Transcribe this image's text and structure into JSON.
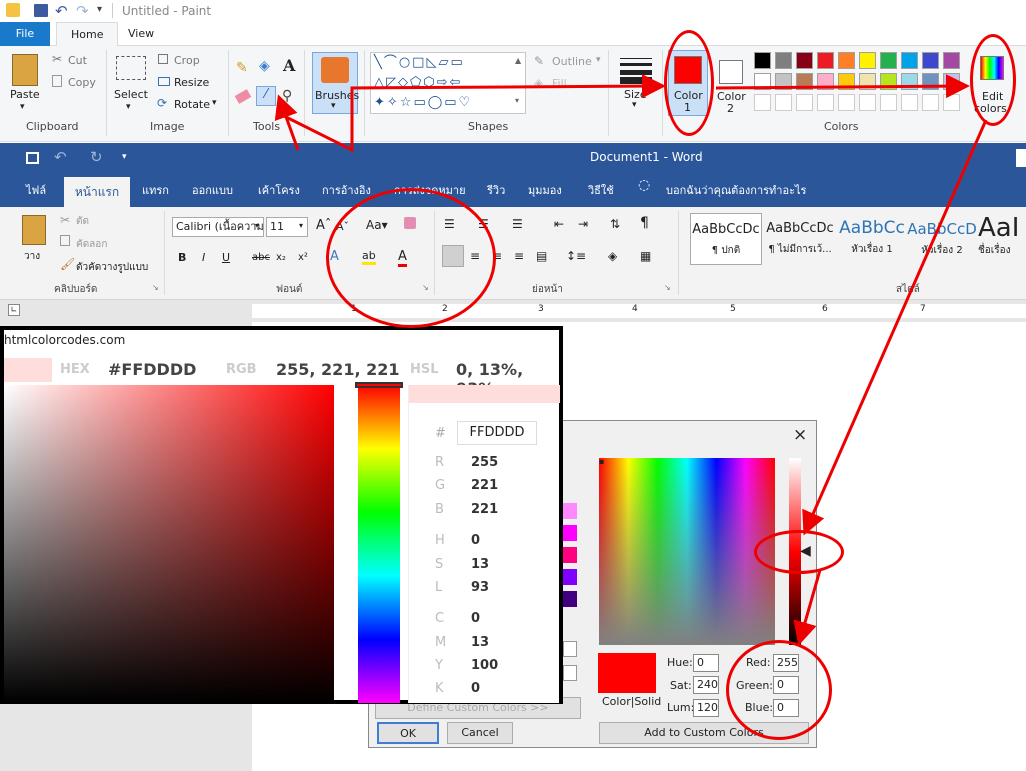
{
  "paint": {
    "title": "Untitled - Paint",
    "tabs": [
      "File",
      "Home",
      "View"
    ],
    "clipboard": {
      "paste": "Paste",
      "cut": "Cut",
      "copy": "Copy",
      "label": "Clipboard"
    },
    "image": {
      "select": "Select",
      "crop": "Crop",
      "resize": "Resize",
      "rotate": "Rotate",
      "label": "Image"
    },
    "tools": {
      "label": "Tools",
      "text_glyph": "A"
    },
    "brushes": "Brushes",
    "shapes": {
      "outline": "Outline",
      "fill": "Fill",
      "label": "Shapes"
    },
    "size": "Size",
    "color1": {
      "line1": "Color",
      "line2": "1",
      "value": "#ff0000"
    },
    "color2": {
      "line1": "Color",
      "line2": "2"
    },
    "colors_label": "Colors",
    "edit_colors": {
      "line1": "Edit",
      "line2": "colors"
    },
    "palette_row1": [
      "#000000",
      "#7f7f7f",
      "#880015",
      "#ed1c24",
      "#ff7f27",
      "#fff200",
      "#22b14c",
      "#00a2e8",
      "#3f48cc",
      "#a349a4"
    ],
    "palette_row2": [
      "#ffffff",
      "#c3c3c3",
      "#b97a57",
      "#ffaec9",
      "#ffc90e",
      "#efe4b0",
      "#b5e61d",
      "#99d9ea",
      "#7092be",
      "#c8bfe7"
    ]
  },
  "word": {
    "title": "Document1 - Word",
    "tabs": [
      "ไฟล์",
      "หน้าแรก",
      "แทรก",
      "ออกแบบ",
      "เค้าโครง",
      "การอ้างอิง",
      "การส่งจดหมาย",
      "รีวิว",
      "มุมมอง",
      "วิธีใช้"
    ],
    "tell_me": "บอกฉันว่าคุณต้องการทำอะไร",
    "paste": "วาง",
    "cut": "ตัด",
    "copy": "คัดลอก",
    "format_painter": "ตัวคัดวางรูปแบบ",
    "clipboard_label": "คลิปบอร์ด",
    "font_name": "Calibri (เนื้อความ",
    "font_size": "11",
    "font_label": "ฟอนต์",
    "paragraph_label": "ย่อหน้า",
    "styles_label": "สไตล์",
    "styles": [
      {
        "sample": "AaBbCcDc",
        "name": "¶ ปกติ"
      },
      {
        "sample": "AaBbCcDc",
        "name": "¶ ไม่มีการเว้..."
      },
      {
        "sample": "AaBbCc",
        "name": "หัวเรื่อง 1"
      },
      {
        "sample": "AaBbCcD",
        "name": "หัวเรื่อง 2"
      },
      {
        "sample": "AaI",
        "name": "ชื่อเรื่อง"
      }
    ],
    "ruler": [
      "1",
      "2",
      "3",
      "4",
      "5",
      "6",
      "7"
    ]
  },
  "htmlcolorcodes": {
    "site": "htmlcolorcodes.com",
    "hex_label": "HEX",
    "hex_value": "#FFDDDD",
    "rgb_label": "RGB",
    "rgb_value": "255, 221, 221",
    "hsl_label": "HSL",
    "hsl_value": "0, 13%, 93%",
    "hash": "#",
    "hex_input": "FFDDDD",
    "fields": [
      {
        "k": "R",
        "v": "255"
      },
      {
        "k": "G",
        "v": "221"
      },
      {
        "k": "B",
        "v": "221"
      },
      {
        "k": "H",
        "v": "0"
      },
      {
        "k": "S",
        "v": "13"
      },
      {
        "k": "L",
        "v": "93"
      },
      {
        "k": "C",
        "v": "0"
      },
      {
        "k": "M",
        "v": "13"
      },
      {
        "k": "Y",
        "v": "100"
      },
      {
        "k": "K",
        "v": "0"
      }
    ],
    "swatch": "#ffdddd"
  },
  "dialog": {
    "close": "×",
    "define_custom": "Define Custom Colors >>",
    "ok": "OK",
    "cancel": "Cancel",
    "color_solid": "Color|Solid",
    "hue_label": "Hue:",
    "hue": "0",
    "sat_label": "Sat:",
    "sat": "240",
    "lum_label": "Lum:",
    "lum": "120",
    "red_label": "Red:",
    "red": "255",
    "green_label": "Green:",
    "green": "0",
    "blue_label": "Blue:",
    "blue": "0",
    "add_custom": "Add to Custom Colors",
    "current": "#ff0000"
  }
}
